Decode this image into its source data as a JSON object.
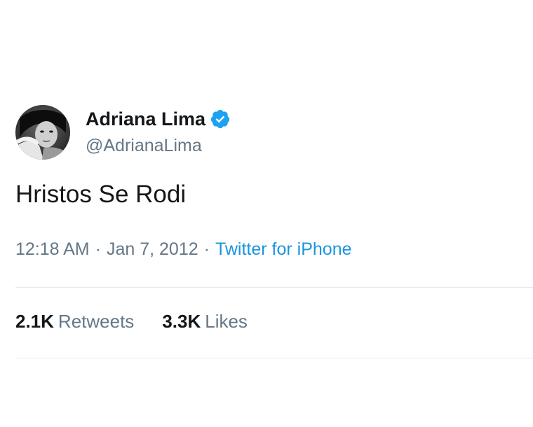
{
  "user": {
    "display_name": "Adriana Lima",
    "handle": "@AdrianaLima",
    "verified": true,
    "avatar_icon": "profile-photo"
  },
  "tweet": {
    "text": "Hristos Se Rodi",
    "time": "12:18 AM",
    "date": "Jan 7, 2012",
    "separator": "·",
    "source": "Twitter for iPhone"
  },
  "stats": {
    "retweets_count": "2.1K",
    "retweets_label": "Retweets",
    "likes_count": "3.3K",
    "likes_label": "Likes"
  },
  "colors": {
    "text": "#14171a",
    "secondary": "#657786",
    "link": "#1b95e0",
    "verified": "#1da1f2",
    "divider": "#e1e8ed"
  }
}
